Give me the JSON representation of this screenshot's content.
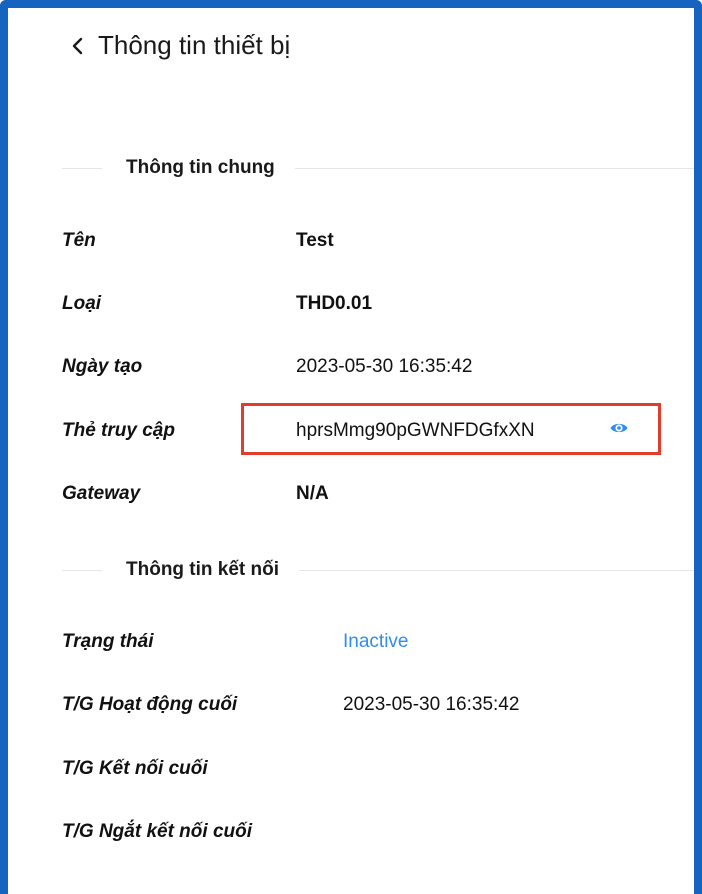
{
  "header": {
    "title": "Thông tin thiết bị",
    "back_icon": "chevron-left-icon"
  },
  "general": {
    "title": "Thông tin chung",
    "rows": [
      {
        "label": "Tên",
        "value": "Test"
      },
      {
        "label": "Loại",
        "value": "THD0.01"
      },
      {
        "label": "Ngày tạo",
        "value": "2023-05-30 16:35:42"
      },
      {
        "label": "Thẻ truy cập",
        "value": "hprsMmg90pGWNFDGfxXN"
      },
      {
        "label": "Gateway",
        "value": "N/A"
      }
    ],
    "reveal_icon": "eye-icon"
  },
  "connection": {
    "title": "Thông tin kết nối",
    "rows": [
      {
        "label": "Trạng thái",
        "value": "Inactive"
      },
      {
        "label": "T/G Hoạt động cuối",
        "value": "2023-05-30 16:35:42"
      },
      {
        "label": "T/G Kết nối cuối",
        "value": ""
      },
      {
        "label": "T/G Ngắt kết nối cuối",
        "value": ""
      }
    ]
  },
  "colors": {
    "frame": "#1565c0",
    "highlight": "#e23c2b",
    "status_inactive": "#2f8cf0"
  }
}
